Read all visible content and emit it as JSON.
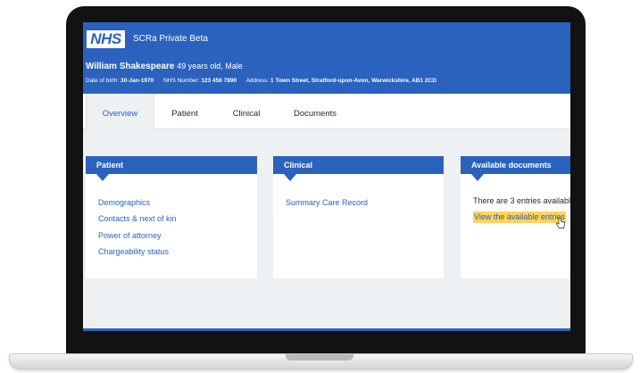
{
  "header": {
    "logo_text": "NHS",
    "app_title": "SCRa Private Beta",
    "patient_name": "William Shakespeare",
    "patient_meta": "49 years old, Male",
    "dob_label": "Date of birth:",
    "dob_value": "30-Jan-1970",
    "nhs_label": "NHS Number:",
    "nhs_value": "123 456 7890",
    "address_label": "Address:",
    "address_value": "1 Town Street, Stratford-upon-Avon, Warwickshire, AB1 2CD"
  },
  "tabs": [
    {
      "label": "Overview",
      "active": true
    },
    {
      "label": "Patient",
      "active": false
    },
    {
      "label": "Clinical",
      "active": false
    },
    {
      "label": "Documents",
      "active": false
    }
  ],
  "cards": {
    "patient": {
      "title": "Patient",
      "links": [
        "Demographics",
        "Contacts & next of kin",
        "Power of attorney",
        "Chargeability status"
      ]
    },
    "clinical": {
      "title": "Clinical",
      "links": [
        "Summary Care Record"
      ]
    },
    "documents": {
      "title": "Available documents",
      "text": "There are 3 entries availabl",
      "link": "View the available entries"
    }
  },
  "colors": {
    "brand_blue": "#2a62be",
    "background": "#eef1f3",
    "highlight": "#ffd45c"
  }
}
